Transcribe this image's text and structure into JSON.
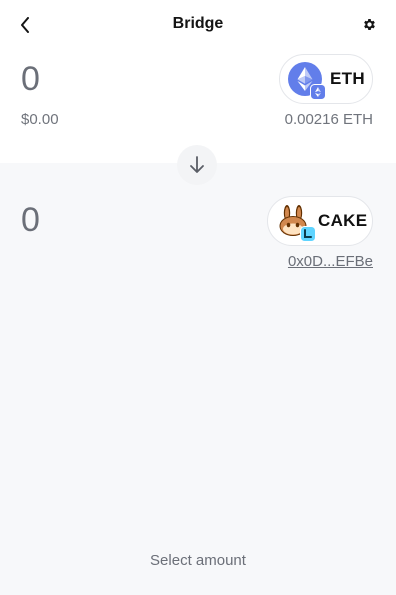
{
  "header": {
    "title": "Bridge",
    "back_icon": "chevron-left-icon",
    "settings_icon": "gear-icon"
  },
  "from": {
    "amount": "0",
    "fiat_value": "$0.00",
    "token": {
      "symbol": "ETH",
      "icon": "ethereum-icon",
      "color": "#627eea"
    },
    "balance": "0.00216 ETH"
  },
  "swap": {
    "icon": "arrow-down-icon"
  },
  "to": {
    "amount": "0",
    "token": {
      "symbol": "CAKE",
      "icon": "pancakeswap-icon"
    },
    "address": "0x0D...EFBe"
  },
  "footer": {
    "text": "Select amount"
  }
}
